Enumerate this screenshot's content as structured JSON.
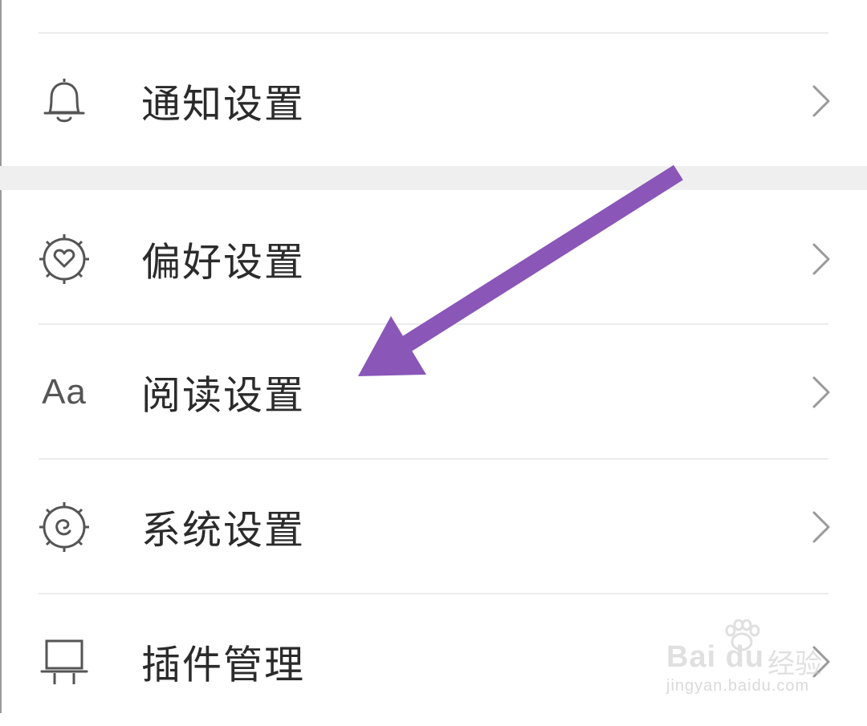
{
  "settings": {
    "items": [
      {
        "label": "通知设置",
        "icon": "bell-icon"
      },
      {
        "label": "偏好设置",
        "icon": "heart-badge-icon"
      },
      {
        "label": "阅读设置",
        "icon": "text-aa-icon",
        "icon_text": "Aa"
      },
      {
        "label": "系统设置",
        "icon": "gear-swirl-icon"
      },
      {
        "label": "插件管理",
        "icon": "plugin-icon"
      }
    ]
  },
  "annotation": {
    "color": "#8a56b8"
  },
  "watermark": {
    "brand": "Bai du",
    "cn": "经验",
    "url": "jingyan.baidu.com"
  }
}
